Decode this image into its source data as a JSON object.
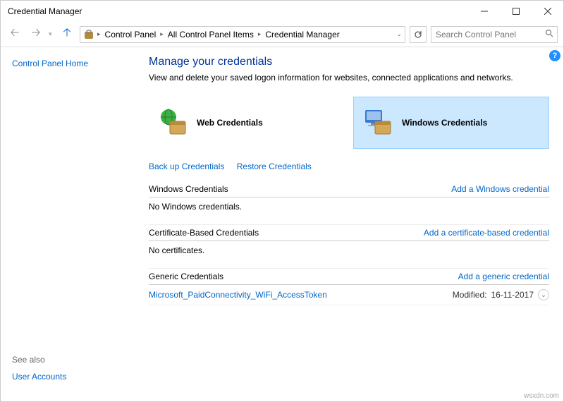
{
  "window": {
    "title": "Credential Manager"
  },
  "breadcrumbs": [
    "Control Panel",
    "All Control Panel Items",
    "Credential Manager"
  ],
  "search": {
    "placeholder": "Search Control Panel"
  },
  "sidebar": {
    "home": "Control Panel Home",
    "seealso_label": "See also",
    "seealso_link": "User Accounts"
  },
  "page": {
    "heading": "Manage your credentials",
    "subheading": "View and delete your saved logon information for websites, connected applications and networks."
  },
  "tiles": {
    "web": "Web Credentials",
    "windows": "Windows Credentials"
  },
  "action_links": {
    "backup": "Back up Credentials",
    "restore": "Restore Credentials"
  },
  "sections": {
    "windows": {
      "title": "Windows Credentials",
      "add": "Add a Windows credential",
      "empty": "No Windows credentials."
    },
    "cert": {
      "title": "Certificate-Based Credentials",
      "add": "Add a certificate-based credential",
      "empty": "No certificates."
    },
    "generic": {
      "title": "Generic Credentials",
      "add": "Add a generic credential"
    }
  },
  "generic_entry": {
    "name": "Microsoft_PaidConnectivity_WiFi_AccessToken",
    "modified_label": "Modified:",
    "modified_date": "16-11-2017"
  },
  "watermark": "wsxdn.com"
}
